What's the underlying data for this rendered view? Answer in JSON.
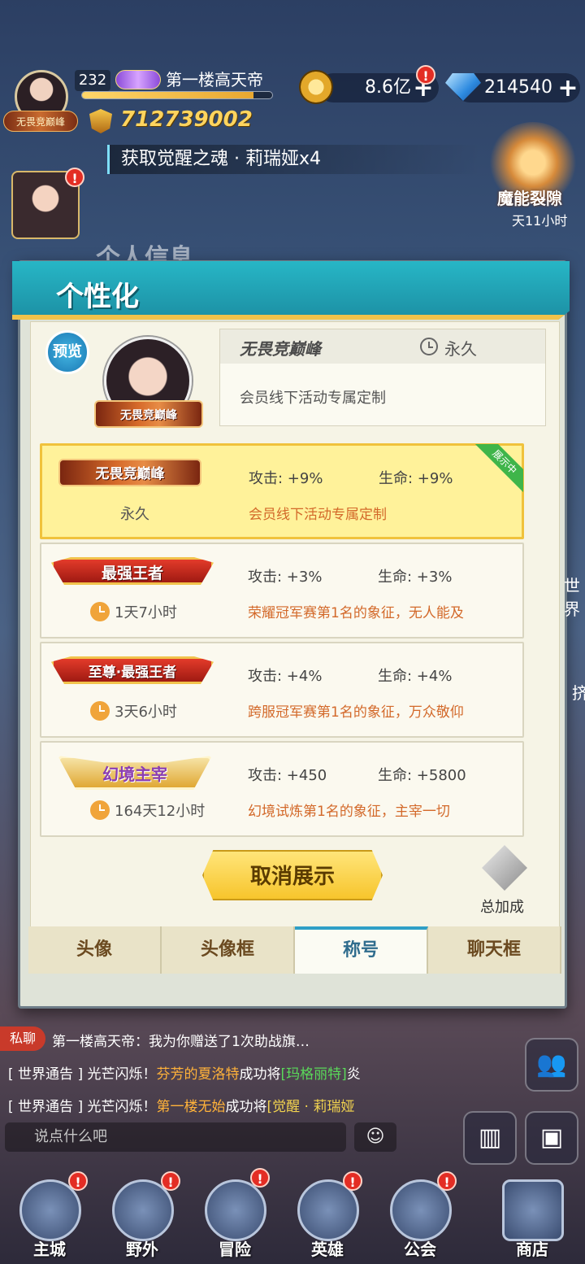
{
  "hud": {
    "level": "232",
    "player_name": "第一楼高天帝",
    "avatar_title": "无畏竞巅峰",
    "power": "712739002",
    "gold": "8.6亿",
    "gems": "214540",
    "xp_progress": 0.9,
    "ticker": "获取觉醒之魂 · 莉瑞娅x4",
    "event_name": "魔能裂隙",
    "event_timer": "天11小时",
    "background_title": "个人信息",
    "badge_mark": "!"
  },
  "dialog": {
    "title": "个性化",
    "preview_label": "预览",
    "preview_avatar_title": "无畏竞巅峰",
    "info": {
      "name": "无畏竞巅峰",
      "duration": "永久",
      "description": "会员线下活动专属定制"
    },
    "titles": [
      {
        "badge": "无畏竞巅峰",
        "duration": "永久",
        "atk": "攻击: +9%",
        "hp": "生命: +9%",
        "desc": "会员线下活动专属定制",
        "showing": "展示中",
        "active": true
      },
      {
        "badge": "最强王者",
        "duration": "1天7小时",
        "atk": "攻击: +3%",
        "hp": "生命: +3%",
        "desc": "荣耀冠军赛第1名的象征，无人能及",
        "active": false
      },
      {
        "badge": "至尊·最强王者",
        "duration": "3天6小时",
        "atk": "攻击: +4%",
        "hp": "生命: +4%",
        "desc": "跨服冠军赛第1名的象征，万众敬仰",
        "active": false
      },
      {
        "badge": "幻境主宰",
        "duration": "164天12小时",
        "atk": "攻击: +450",
        "hp": "生命: +5800",
        "desc": "幻境试炼第1名的象征，主宰一切",
        "active": false
      }
    ],
    "cancel_label": "取消展示",
    "total_label": "总加成",
    "tabs": [
      "头像",
      "头像框",
      "称号",
      "聊天框"
    ],
    "selected_tab": 2
  },
  "chat": {
    "private_label": "私聊",
    "line1": "第一楼高天帝：我为你赠送了1次助战旗…",
    "line2_prefix": "[ 世界通告 ] 光芒闪烁！",
    "line2_name": "芬芳的夏洛特",
    "line2_mid": "成功将",
    "line2_item": "[玛格丽特]",
    "line2_tail": "炎",
    "line3_prefix": "[ 世界通告 ] 光芒闪烁！",
    "line3_name": "第一楼无始",
    "line3_mid": "成功将",
    "line3_item": "[觉醒 · 莉瑞娅",
    "input_placeholder": "说点什么吧",
    "side_text_1": "世界",
    "side_text_2": "挤"
  },
  "nav": {
    "items": [
      "主城",
      "野外",
      "冒险",
      "英雄",
      "公会",
      "商店"
    ]
  }
}
